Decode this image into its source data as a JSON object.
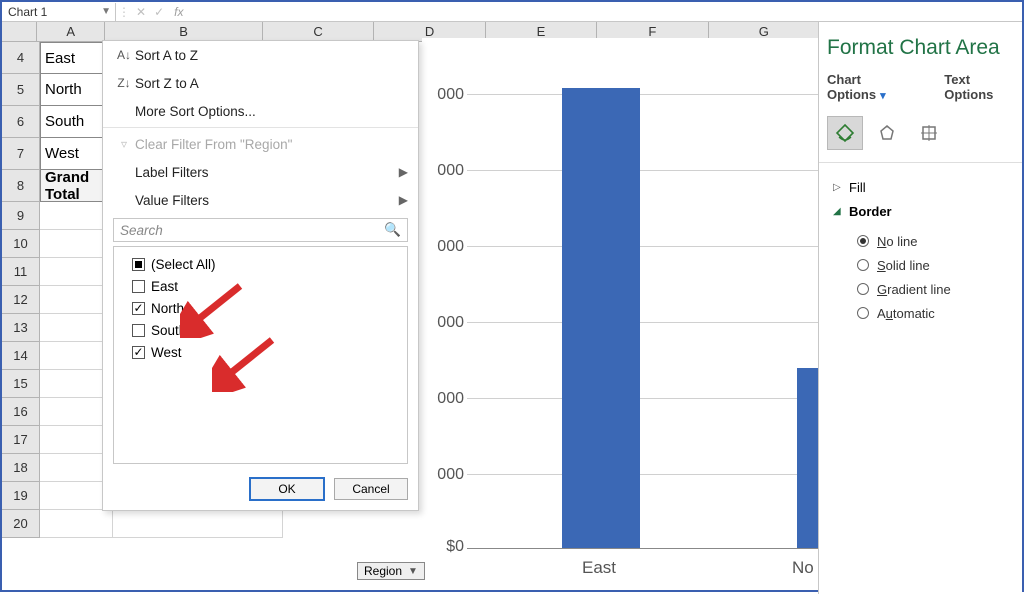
{
  "formula_bar": {
    "name_box": "Chart 1",
    "fx_label": "fx"
  },
  "columns": [
    "A",
    "B",
    "C",
    "D",
    "E",
    "F",
    "G"
  ],
  "row_numbers": [
    4,
    5,
    6,
    7,
    8,
    9,
    10,
    11,
    12,
    13,
    14,
    15,
    16,
    17,
    18,
    19,
    20
  ],
  "pivot_rows": [
    "East",
    "North",
    "South",
    "West",
    "Grand Total"
  ],
  "context_menu": {
    "sort_az": "Sort A to Z",
    "sort_za": "Sort Z to A",
    "more_sort": "More Sort Options...",
    "clear_filter": "Clear Filter From \"Region\"",
    "label_filters": "Label Filters",
    "value_filters": "Value Filters",
    "search_placeholder": "Search",
    "items": [
      {
        "label": "(Select All)",
        "state": "partial"
      },
      {
        "label": "East",
        "state": "unchecked"
      },
      {
        "label": "North",
        "state": "checked"
      },
      {
        "label": "South",
        "state": "unchecked"
      },
      {
        "label": "West",
        "state": "checked"
      }
    ],
    "ok": "OK",
    "cancel": "Cancel"
  },
  "region_button": "Region",
  "format_pane": {
    "title": "Format Chart Area",
    "chart_options": "Chart Options",
    "text_options": "Text Options",
    "fill": "Fill",
    "border": "Border",
    "border_opts": {
      "no_line": "No line",
      "solid": "Solid line",
      "gradient": "Gradient line",
      "auto": "Automatic"
    }
  },
  "chart_data": {
    "type": "bar",
    "categories": [
      "East",
      "North"
    ],
    "values": [
      5400,
      2000
    ],
    "xlabel": "",
    "ylabel": "",
    "y_ticks_visible": [
      "000",
      "000",
      "000",
      "000",
      "000",
      "000",
      "$0"
    ],
    "note": "First y-axis tick labels truncated by overlapping menu; visible categories on x-axis are East and partial 'No...'",
    "ylim": [
      0,
      6000
    ]
  }
}
